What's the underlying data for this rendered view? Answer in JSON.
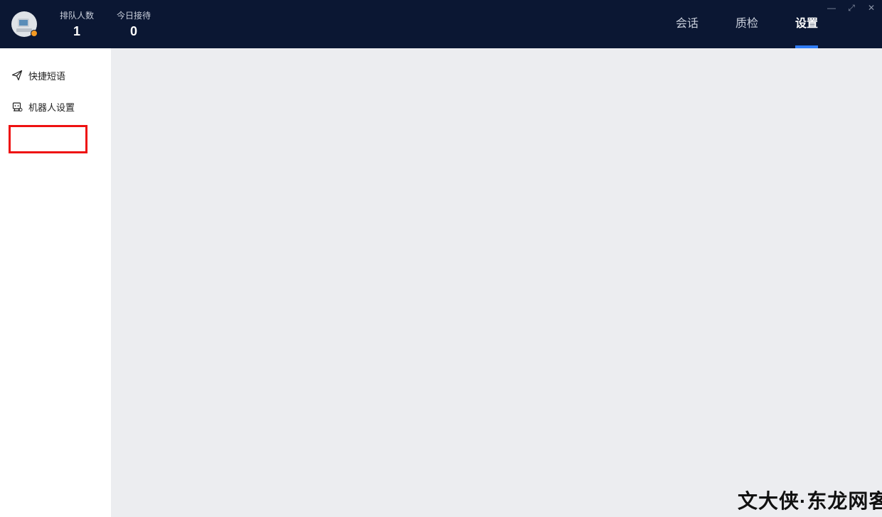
{
  "header": {
    "stats": [
      {
        "label": "排队人数",
        "value": "1"
      },
      {
        "label": "今日接待",
        "value": "0"
      }
    ],
    "tabs": [
      {
        "label": "会话",
        "active": false
      },
      {
        "label": "质检",
        "active": false
      },
      {
        "label": "设置",
        "active": true
      }
    ],
    "window_controls": {
      "minimize": "—",
      "maximize": "⤢",
      "close": "✕"
    },
    "status_color": "#f59a23",
    "accent_color": "#2f7cf6"
  },
  "sidebar": {
    "items": [
      {
        "label": "快捷短语",
        "icon": "paper-plane-icon"
      },
      {
        "label": "机器人设置",
        "icon": "robot-icon"
      }
    ]
  },
  "watermark": {
    "text": "文大侠·东龙网客"
  }
}
